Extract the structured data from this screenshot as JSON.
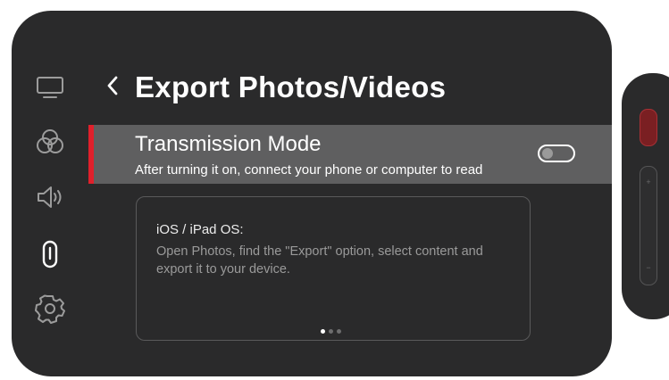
{
  "header": {
    "title": "Export Photos/Videos"
  },
  "sidebar": {
    "items": [
      {
        "icon": "display-icon",
        "active": false
      },
      {
        "icon": "color-circles-icon",
        "active": false
      },
      {
        "icon": "speaker-icon",
        "active": false
      },
      {
        "icon": "export-clip-icon",
        "active": true
      },
      {
        "icon": "gear-icon",
        "active": false
      }
    ]
  },
  "transmission": {
    "title": "Transmission Mode",
    "description": "After turning it on, connect your phone or computer to read",
    "enabled": false
  },
  "info_card": {
    "title": "iOS / iPad OS:",
    "body": "Open Photos, find the \"Export\" option, select content and export it to your device.",
    "page_count": 3,
    "current_page": 1
  },
  "device_controls": {
    "plus_label": "+",
    "minus_label": "−"
  },
  "colors": {
    "accent": "#e0202b",
    "background": "#2a2a2b",
    "highlight_row": "#5f5f60",
    "card_border": "#5a5a5b",
    "muted_text": "#9a9a9a"
  }
}
